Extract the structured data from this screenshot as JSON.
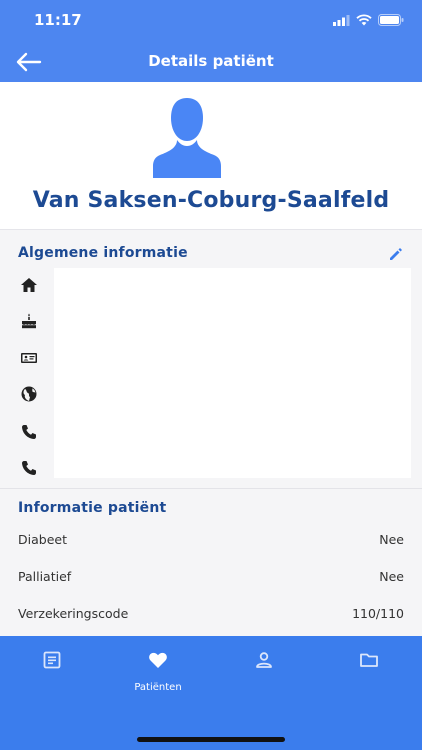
{
  "status_bar": {
    "time": "11:17"
  },
  "header": {
    "title": "Details patiënt"
  },
  "patient": {
    "name": "Van Saksen-Coburg-Saalfeld"
  },
  "general": {
    "title": "Algemene informatie",
    "icons": [
      "home-icon",
      "cake-icon",
      "id-card-icon",
      "globe-icon",
      "phone-icon",
      "phone-icon"
    ]
  },
  "patient_info": {
    "title": "Informatie patiënt",
    "rows": [
      {
        "label": "Diabeet",
        "value": "Nee"
      },
      {
        "label": "Palliatief",
        "value": "Nee"
      },
      {
        "label": "Verzekeringscode",
        "value": "110/110"
      }
    ]
  },
  "tabbar": {
    "tabs": [
      {
        "icon": "document-icon",
        "label": ""
      },
      {
        "icon": "heart-icon",
        "label": "Patiënten"
      },
      {
        "icon": "person-icon",
        "label": ""
      },
      {
        "icon": "folder-icon",
        "label": ""
      }
    ]
  },
  "colors": {
    "header": "#4d86f0",
    "tabbar": "#3b7ded",
    "accent": "#1d4a93"
  }
}
